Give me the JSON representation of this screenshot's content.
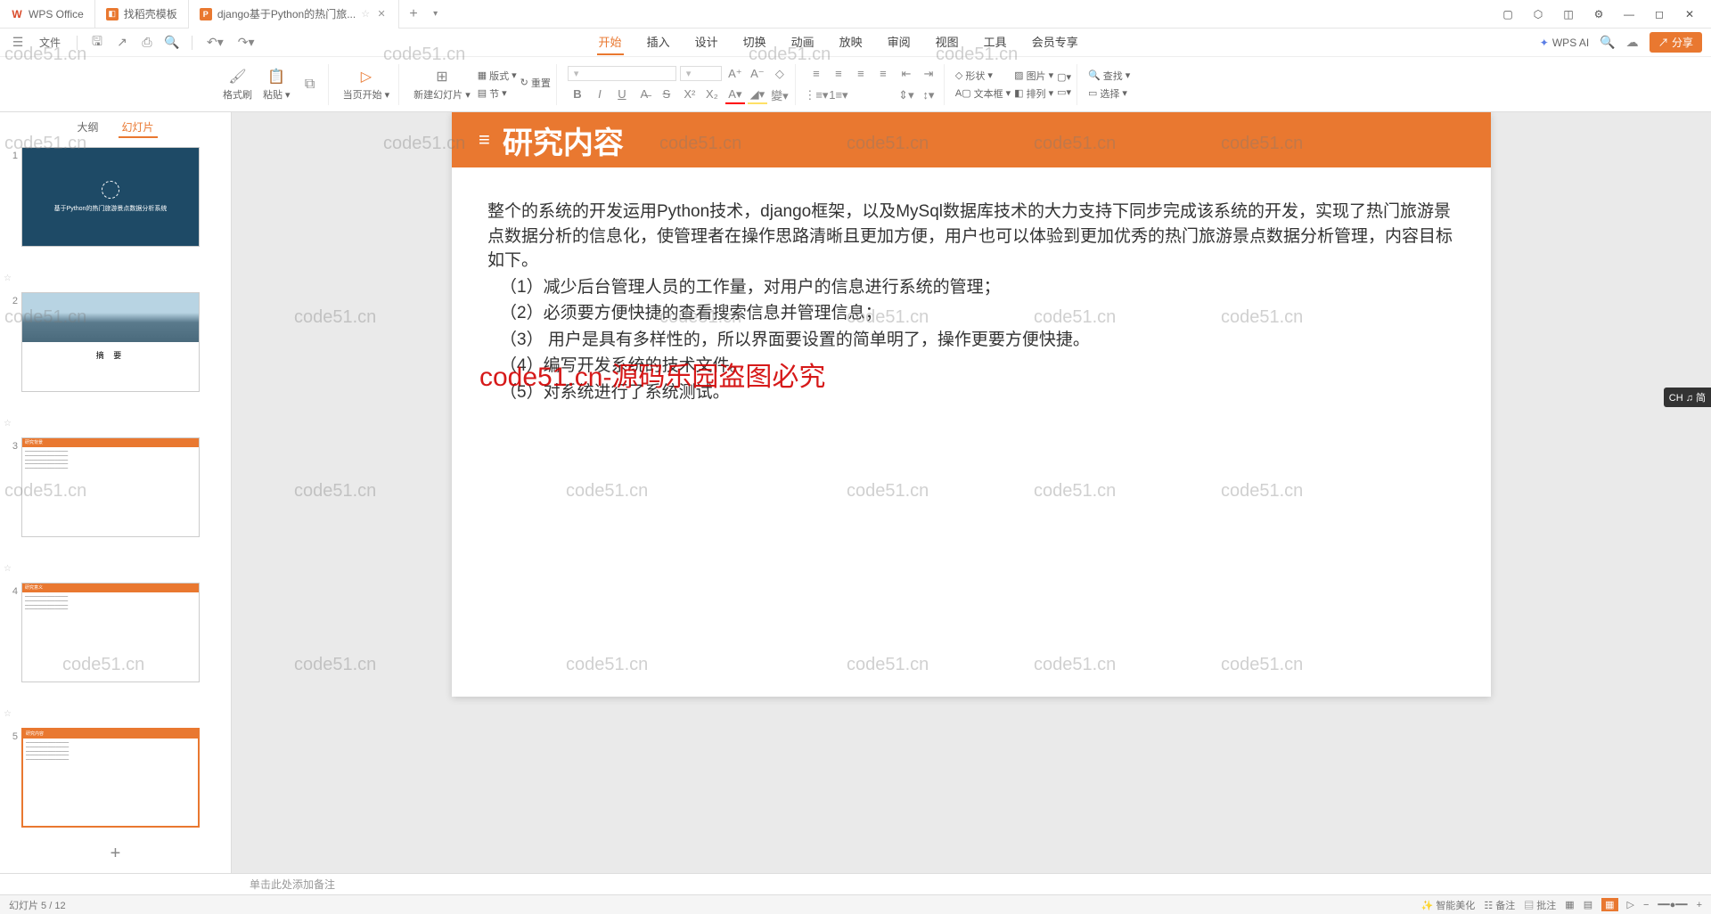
{
  "titlebar": {
    "tabs": [
      {
        "icon": "W",
        "iconColor": "#d94b2b",
        "label": "WPS Office"
      },
      {
        "icon": "◧",
        "iconColor": "#e97830",
        "label": "找稻壳模板"
      },
      {
        "icon": "P",
        "iconColor": "#e97830",
        "label": "django基于Python的热门旅...",
        "closable": true,
        "starred": true
      }
    ],
    "addTab": "+"
  },
  "menubar": {
    "file": "文件",
    "tabs": [
      "开始",
      "插入",
      "设计",
      "切换",
      "动画",
      "放映",
      "审阅",
      "视图",
      "工具",
      "会员专享"
    ],
    "activeTab": 0,
    "wpsAi": "WPS AI",
    "share": "分享"
  },
  "ribbon": {
    "formatPainter": "格式刷",
    "paste": "粘贴",
    "fromCurrent": "当页开始",
    "newSlide": "新建幻灯片",
    "layout": "版式",
    "reset": "重置",
    "section": "节",
    "shape": "形状",
    "image": "图片",
    "textbox": "文本框",
    "arrange": "排列",
    "find": "查找",
    "select": "选择"
  },
  "thumbs": {
    "tab_outline": "大纲",
    "tab_slides": "幻灯片",
    "slides": [
      {
        "num": 1,
        "title": "基于Python的热门旅游景点数据分析系统"
      },
      {
        "num": 2,
        "title": "摘 要"
      },
      {
        "num": 3,
        "title": "研究背景"
      },
      {
        "num": 4,
        "title": "研究意义"
      },
      {
        "num": 5,
        "title": "研究内容"
      }
    ]
  },
  "slide": {
    "headerTitle": "研究内容",
    "para1": "整个的系统的开发运用Python技术，django框架，以及MySql数据库技术的大力支持下同步完成该系统的开发，实现了热门旅游景点数据分析的信息化，使管理者在操作思路清晰且更加方便，用户也可以体验到更加优秀的热门旅游景点数据分析管理，内容目标如下。",
    "item1": "（1）减少后台管理人员的工作量，对用户的信息进行系统的管理；",
    "item2": "（2）必须要方便快捷的查看搜索信息并管理信息；",
    "item3": "（3） 用户是具有多样性的，所以界面要设置的简单明了，操作更要方便快捷。",
    "item4": "（4）编写开发系统的技术文件。",
    "item5": "（5）对系统进行了系统测试。"
  },
  "notes": {
    "placeholder": "单击此处添加备注"
  },
  "status": {
    "slideInfo": "幻灯片 5 / 12",
    "smartify": "智能美化",
    "remarks": "备注",
    "comments": "批注"
  },
  "watermark_text": "code51.cn",
  "watermark_red": "code51.cn-源码乐园盗图必究",
  "ime": "CH ♫ 简"
}
